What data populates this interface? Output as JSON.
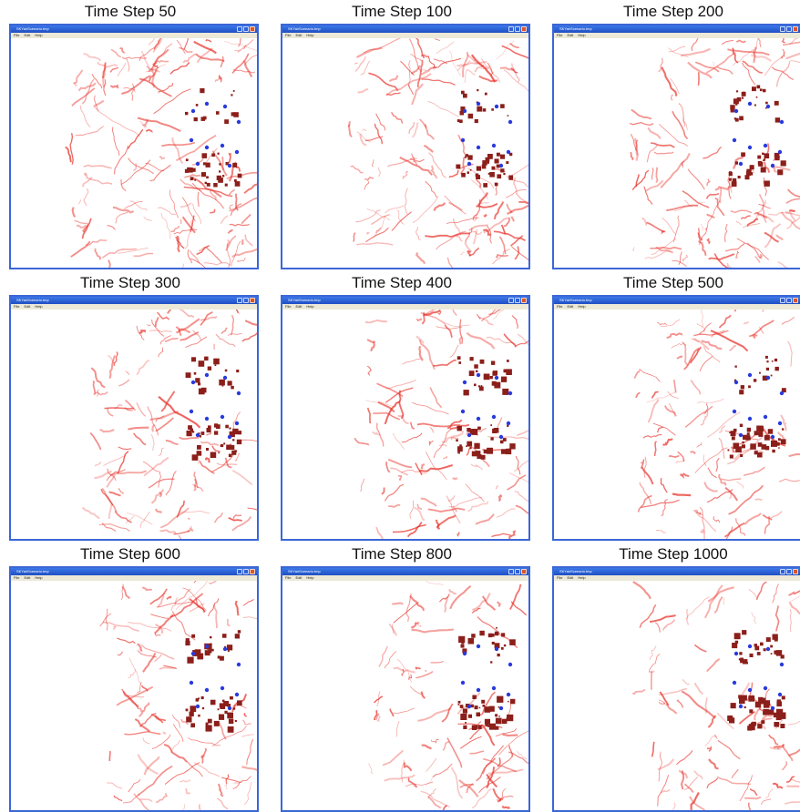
{
  "window": {
    "title": "SKYairScenario.tmp",
    "menu": [
      "File",
      "Edit",
      "Help"
    ]
  },
  "colors": {
    "trail": "#e8322a",
    "agent": "#8b1f1a",
    "beacon": "#2a3bdc",
    "window_border": "#3b66d6",
    "titlebar": "#2457d0"
  },
  "panels": [
    {
      "label": "Time Step 50",
      "step": 50
    },
    {
      "label": "Time Step 100",
      "step": 100
    },
    {
      "label": "Time Step 200",
      "step": 200
    },
    {
      "label": "Time Step 300",
      "step": 300
    },
    {
      "label": "Time Step 400",
      "step": 400
    },
    {
      "label": "Time Step 500",
      "step": 500
    },
    {
      "label": "Time Step 600",
      "step": 600
    },
    {
      "label": "Time Step 800",
      "step": 800
    },
    {
      "label": "Time Step 1000",
      "step": 1000
    }
  ]
}
